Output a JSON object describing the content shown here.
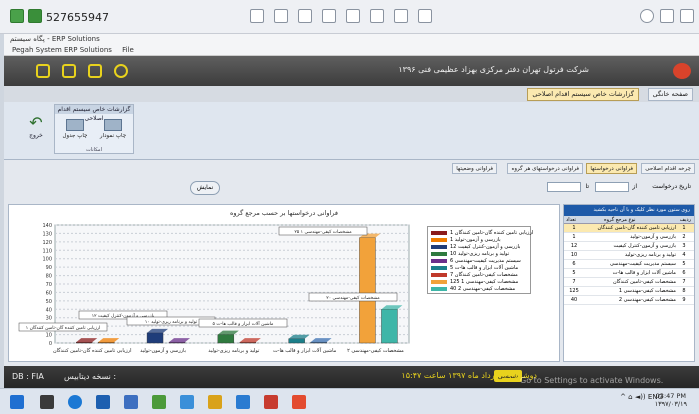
{
  "remote": {
    "session_id": "527655947"
  },
  "window": {
    "title": "پگاه سیستم - ERP Solutions",
    "menu": [
      "Pegah System ERP Solutions",
      "File"
    ]
  },
  "header": {
    "user_info": "شرکت فرتول تهران  دفتر مرکزی  بهزاد عظیمی فنی",
    "year": "۱۳۹۶"
  },
  "tabs": [
    {
      "label": "صفحه خانگی"
    },
    {
      "label": "گزارشات خاص سیستم اقدام اصلاحی"
    }
  ],
  "ribbon": {
    "group_title": "گزارشات خاص سیستم اقدام اصلاحی",
    "buttons": [
      {
        "label": "چاپ جدول"
      },
      {
        "label": "چاپ نمودار"
      }
    ],
    "group_footer": "امکانات",
    "exit_label": "خروج"
  },
  "subtabs": [
    {
      "label": "چرخه اقدام اصلاحی",
      "active": false
    },
    {
      "label": "فراوانی درخواستها",
      "active": true
    },
    {
      "label": "فراوانی درخواستهای هر گروه",
      "active": false
    },
    {
      "label": "فراوانی وضعیتها",
      "active": false
    }
  ],
  "filter": {
    "date_label": "تاریخ درخواست",
    "from": "از",
    "to": "تا",
    "display_button": "نمایش"
  },
  "chart_data": {
    "type": "bar",
    "title": "فراوانی درخواستها بر حسب مرجع گروه",
    "categories": [
      "ارزیابی تامین کننده گان-تامین کنندگان",
      "بازرسی و آزمون-تولید",
      "تولید و برنامه ریزی-تولید",
      "ماشین آلات ابزار و قالب ها-ت",
      "مشخصات کیفی-مهندسی ۲"
    ],
    "values": [
      1,
      12,
      10,
      5,
      125
    ],
    "second_values": [
      1,
      1,
      1,
      1,
      40
    ],
    "ylim": [
      0,
      140
    ],
    "yticks": [
      0,
      10,
      20,
      30,
      40,
      50,
      60,
      70,
      80,
      90,
      100,
      110,
      120,
      130,
      140
    ],
    "data_labels": [
      "ارزیابی تامین کننده گان-تامین کنندگان ۱",
      "بازرسی و آزمون-کنترل کیفیت ۱۲",
      "تولید و برنامه ریزی-تولید ۱۰",
      "ماشین آلات ابزار و قالب ها-ت ۵",
      "مشخصات کیفی-مهندسی ۱ ۲۵",
      "مشخصات کیفی-مهندسی ۲۰"
    ],
    "legend": [
      {
        "label": "ارزیابی تامین کننده گان-تامین کنندگان 1",
        "color": "#8b1c1c"
      },
      {
        "label": "بازرسی و آزمون-تولید 1",
        "color": "#f07d00"
      },
      {
        "label": "بازرسی و آزمون-کنترل کیفیت 12",
        "color": "#1f3d7a"
      },
      {
        "label": "تولید و برنامه ریزی-تولید 10",
        "color": "#2f7a3f"
      },
      {
        "label": "سیستم مدیریت کیفیت-مهندسی 6",
        "color": "#6a2f8a"
      },
      {
        "label": "ماشین آلات ابزار و قالب ها-ت 5",
        "color": "#1b7f8a"
      },
      {
        "label": "مشخصات کیفی-تامین کنندگان 7",
        "color": "#c0392b"
      },
      {
        "label": "مشخصات کیفی-مهندسی 1 125",
        "color": "#f2a23a"
      },
      {
        "label": "مشخصات کیفی-مهندسی 2 40",
        "color": "#3fb6a8"
      }
    ]
  },
  "side_panel": {
    "header": "روی ستون مورد نظر کلیک و با آن ناحیه بکشید",
    "columns": {
      "row": "ردیف",
      "ref": "نوع مرجع گروه",
      "count": "تعداد"
    },
    "rows": [
      {
        "n": "1",
        "ref": "ارزیابی تامین کننده گان-تامین کنندگان",
        "count": "1"
      },
      {
        "n": "2",
        "ref": "بازرسی و آزمون-تولید",
        "count": "1"
      },
      {
        "n": "3",
        "ref": "بازرسی و آزمون-کنترل کیفیت",
        "count": "12"
      },
      {
        "n": "4",
        "ref": "تولید و برنامه ریزی-تولید",
        "count": "10"
      },
      {
        "n": "5",
        "ref": "سیستم مدیریت کیفیت-مهندسی",
        "count": "6"
      },
      {
        "n": "6",
        "ref": "ماشین آلات ابزار و قالب ها-ت",
        "count": "5"
      },
      {
        "n": "7",
        "ref": "مشخصات کیفی-تامین کنندگان",
        "count": "7"
      },
      {
        "n": "8",
        "ref": "مشخصات کیفی-مهندسی 1",
        "count": "125"
      },
      {
        "n": "9",
        "ref": "مشخصات کیفی-مهندسی 2",
        "count": "40"
      }
    ]
  },
  "status": {
    "db": "DB : FIA",
    "version_label": "نسخه دیتابیس :",
    "datetime": "دوشنبه ۱۹ خرداد ماه ۱۳۹۷ ساعت ۱۵:۴۷",
    "shamsi": "شمسی"
  },
  "watermark": "Go to Settings to activate Windows.",
  "taskbar": {
    "lang": "ENG",
    "time": "03:47 PM",
    "date": "۱۳۹۷/۰۳/۱۹"
  }
}
